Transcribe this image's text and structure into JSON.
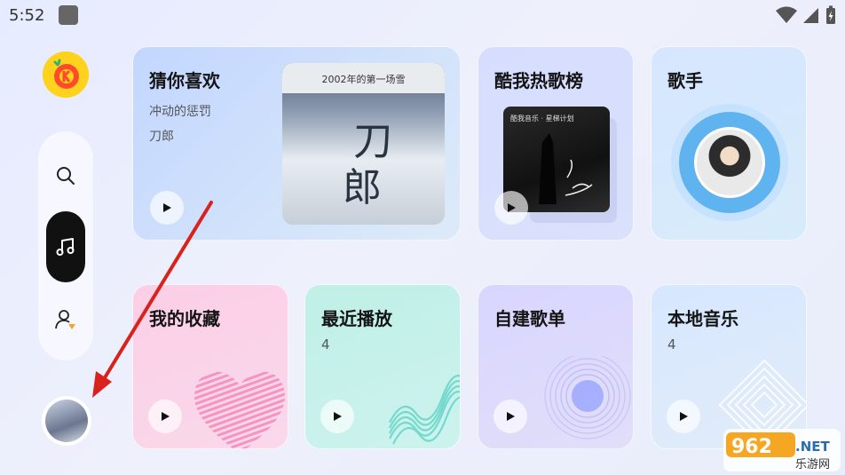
{
  "status_bar": {
    "time": "5:52"
  },
  "sidebar": {
    "logo_icon": "k-music-logo-icon",
    "items": [
      {
        "name": "search",
        "icon": "search-icon"
      },
      {
        "name": "music",
        "icon": "music-note-icon",
        "active": true
      },
      {
        "name": "profile",
        "icon": "user-icon"
      }
    ]
  },
  "cards": {
    "guess": {
      "title": "猜你喜欢",
      "song": "冲动的惩罚",
      "artist": "刀郎",
      "cover_band": "2002年的第一场雪",
      "cover_chars": [
        "刀",
        "郎"
      ]
    },
    "hot": {
      "title": "酷我热歌榜",
      "cover_text": "酷我音乐 · 星梯计划"
    },
    "singer": {
      "title": "歌手"
    },
    "favorites": {
      "title": "我的收藏"
    },
    "recent": {
      "title": "最近播放",
      "count": "4"
    },
    "playlist": {
      "title": "自建歌单"
    },
    "local": {
      "title": "本地音乐",
      "count": "4"
    }
  },
  "watermark": {
    "top": "962",
    "suffix": ".NET",
    "bottom": "乐游网"
  },
  "colors": {
    "accent_black": "#111111",
    "logo_yellow": "#ffd21e",
    "arrow_red": "#d9221c"
  }
}
